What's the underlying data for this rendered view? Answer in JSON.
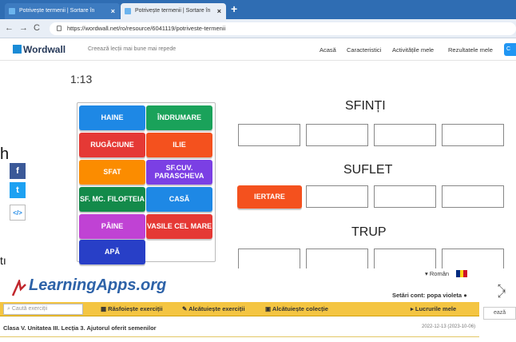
{
  "browser": {
    "tabs": [
      {
        "title": "Potrivește termenii | Sortare în",
        "active": false
      },
      {
        "title": "Potrivește termenii | Sortare în",
        "active": true
      }
    ],
    "url": "https://wordwall.net/ro/resource/6041119/potriveste-termenii"
  },
  "wordwall": {
    "brand": "Wordwall",
    "tagline": "Creează lecții mai bune mai repede",
    "menu": [
      "Acasă",
      "Caracteristici",
      "Activitățile mele",
      "Rezultatele mele"
    ],
    "cta": "C"
  },
  "activity": {
    "timer": "1:13",
    "tiles": [
      {
        "label": "HAINE",
        "color": "#1e88e5"
      },
      {
        "label": "ÎNDRUMARE",
        "color": "#1aa25a"
      },
      {
        "label": "RUGĂCIUNE",
        "color": "#e53935"
      },
      {
        "label": "ILIE",
        "color": "#f4511e"
      },
      {
        "label": "SFAT",
        "color": "#fb8c00"
      },
      {
        "label": "SF.CUV. PARASCHEVA",
        "color": "#7b3fe4"
      },
      {
        "label": "SF. MC. FILOFTEIA",
        "color": "#138a4a"
      },
      {
        "label": "CASĂ",
        "color": "#1e88e5"
      },
      {
        "label": "PÂINE",
        "color": "#c042d4"
      },
      {
        "label": "VASILE CEL MARE",
        "color": "#e53935"
      },
      {
        "label": "APĂ",
        "color": "#283fc7"
      }
    ],
    "groups": [
      {
        "title": "SFINȚI"
      },
      {
        "title": "SUFLET",
        "placed": {
          "label": "IERTARE",
          "color": "#f4511e"
        }
      },
      {
        "title": "TRUP"
      }
    ]
  },
  "page_fragments": {
    "left_text": "h",
    "bottom_left_text": "tı"
  },
  "learningapps": {
    "brand": "LearningApps.org",
    "language": "Român",
    "account": "Setări cont: popa violeta",
    "search_placeholder": "Caută exerciții",
    "nav": [
      "Răsfoiește exerciții",
      "Alcătuiește exerciții",
      "Alcătuiește colecție",
      "Lucrurile mele"
    ],
    "side_button": "ează",
    "title": "Clasa V. Unitatea III. Lecția 3. Ajutorul oferit semenilor",
    "date": "2022-12-13",
    "date_small": "(2023-10-06)"
  }
}
